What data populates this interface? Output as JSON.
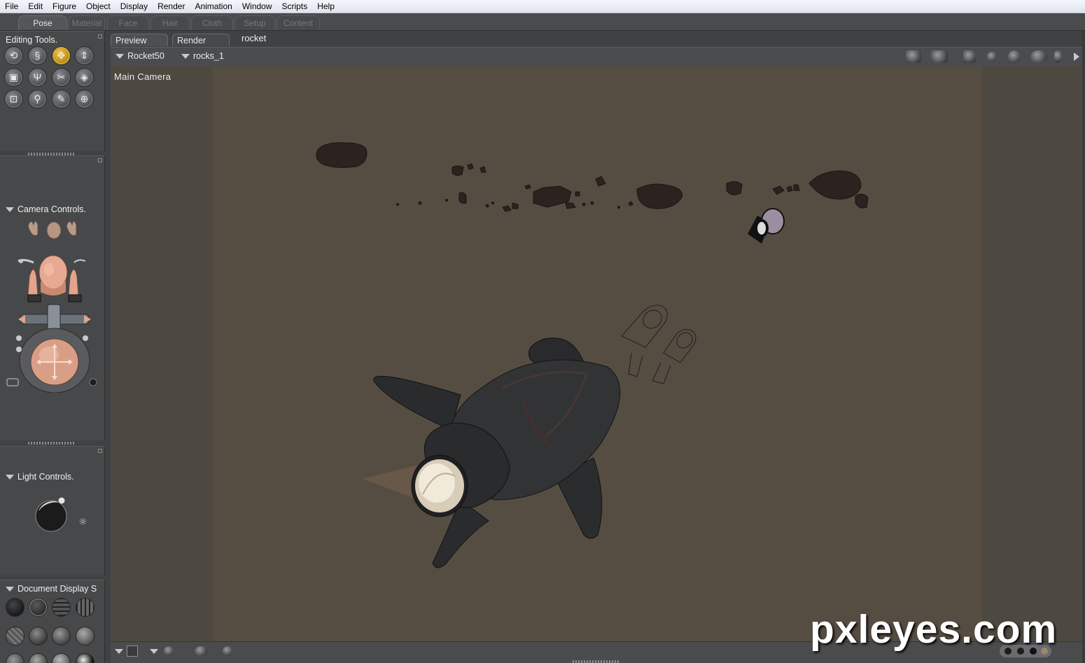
{
  "menu": [
    "File",
    "Edit",
    "Figure",
    "Object",
    "Display",
    "Render",
    "Animation",
    "Window",
    "Scripts",
    "Help"
  ],
  "rooms": [
    "Pose",
    "Material",
    "Face",
    "Hair",
    "Cloth",
    "Setup",
    "Content"
  ],
  "active_room": "Pose",
  "editing_tools": {
    "title": "Editing Tools.",
    "tools": [
      "rotate-icon",
      "twist-icon",
      "translate-icon",
      "translate-in-out-icon",
      "scale-icon",
      "taper-icon",
      "chain-break-icon",
      "color-icon",
      "grouping-icon",
      "view-magnifier-icon",
      "morph-brush-icon",
      "direct-manipulation-icon"
    ],
    "selected_tool": "translate-icon"
  },
  "camera_controls": {
    "title": "Camera Controls."
  },
  "light_controls": {
    "title": "Light Controls."
  },
  "document_display": {
    "title": "Document Display S"
  },
  "doc_tabs": [
    "Preview",
    "Render"
  ],
  "document_name": "rocket",
  "figure_selector": "Rocket50",
  "actor_selector": "rocks_1",
  "viewport": {
    "camera_label": "Main Camera"
  },
  "watermark": "pxleyes.com",
  "colors": {
    "viewport_bg": "#564d42",
    "panel_bg": "#474849",
    "tool_selected": "#e2b332"
  }
}
